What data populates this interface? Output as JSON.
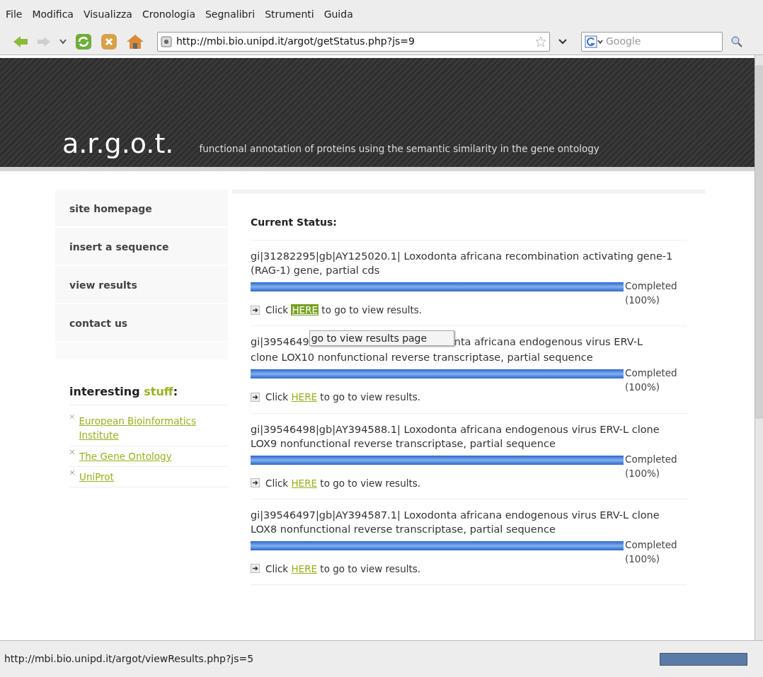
{
  "menu_bar": [
    "File",
    "Modifica",
    "Visualizza",
    "Cronologia",
    "Segnalibri",
    "Strumenti",
    "Guida"
  ],
  "toolbar": {
    "url": "http://mbi.bio.unipd.it/argot/getStatus.php?js=9",
    "search_placeholder": "Google"
  },
  "header": {
    "logo": "a.r.g.o.t.",
    "tagline": "functional annotation of proteins using the semantic similarity in the gene ontology"
  },
  "sidebar": {
    "nav": [
      "site homepage",
      "insert a sequence",
      "view results",
      "contact us"
    ],
    "links_title": {
      "text": "interesting",
      "highlight": "stuff",
      "colon": ":"
    },
    "links": [
      "European Bioinformatics Institute",
      "The Gene Ontology",
      "UniProt"
    ]
  },
  "status": {
    "title": "Current Status:",
    "jobs": [
      {
        "title": "gi|31282295|gb|AY125020.1| Loxodonta africana recombination activating gene-1 (RAG-1) gene, partial cds",
        "level": 1,
        "state": "Completed",
        "percent": "(100%)",
        "click": "Click",
        "link": "HERE",
        "rest": "to go to view results.",
        "hovered": true
      },
      {
        "title": "gi|3954649",
        "tooltip": "go to view results page",
        "title_after": "nta africana endogenous virus ERV-L",
        "title_line2": "clone LOX10 nonfunctional reverse transcriptase, partial sequence",
        "level": 1,
        "state": "Completed",
        "percent": "(100%)",
        "click": "Click",
        "link": "HERE",
        "rest": "to go to view results.",
        "hovered": false
      },
      {
        "title": "gi|39546498|gb|AY394588.1| Loxodonta africana endogenous virus ERV-L clone LOX9 nonfunctional reverse transcriptase, partial sequence",
        "level": 1,
        "state": "Completed",
        "percent": "(100%)",
        "click": "Click",
        "link": "HERE",
        "rest": "to go to view results.",
        "hovered": false
      },
      {
        "title": "gi|39546497|gb|AY394587.1| Loxodonta africana endogenous virus ERV-L clone LOX8 nonfunctional reverse transcriptase, partial sequence",
        "level": 1,
        "state": "Completed",
        "percent": "(100%)",
        "click": "Click",
        "link": "HERE",
        "rest": "to go to view results.",
        "hovered": false
      }
    ]
  },
  "status_bar": "http://mbi.bio.unipd.it/argot/viewResults.php?js=5"
}
